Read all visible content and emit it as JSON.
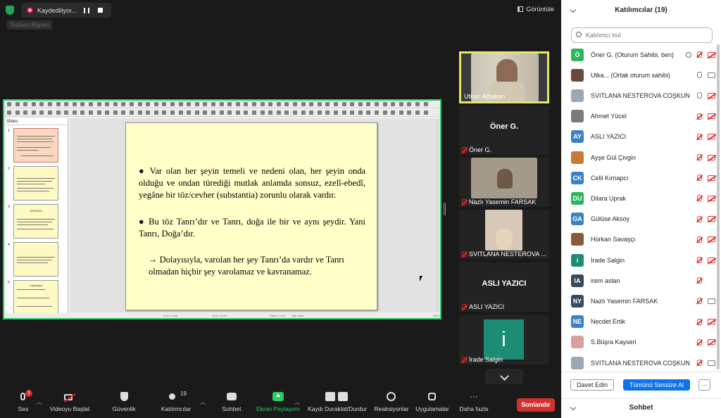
{
  "topbar": {
    "recording_label": "Kaydediliyor...",
    "meeting_info": "Toplantı Bilgileri",
    "view_label": "Görüntüle"
  },
  "slide": {
    "pane_title": "Slides",
    "bullet1": "● Var olan her şeyin temeli ve nedeni olan, her şeyin onda olduğu ve ondan türediği mutlak anlamda sonsuz, ezelî-ebedî, yegâne bir töz/cevher (substantia) zorunlu olarak vardır.",
    "bullet2": "● Bu töz Tanrı’dır ve Tanrı, doğa ile bir ve aynı şeydir.  Yani Tanrı, Doğa’dır.",
    "bullet3": "→  Dolayısıyla, varolan her şey Tanrı’da vardır ve Tanrı olmadan hiçbir şey varolamaz ve kavranamaz.",
    "thumb_numbers": [
      "1",
      "2",
      "3",
      "4",
      "5"
    ],
    "thumb3_title": "SPINOZA",
    "thumb5_title": "Kaynakça",
    "status": [
      "12,97 / 6,85",
      "0,00 x 0,00",
      "Slide 1 of 12",
      "Title Slide",
      "82%"
    ]
  },
  "video_tiles": [
    {
      "name": "Utkan Atbakan",
      "active": true
    },
    {
      "name": "Öner G.",
      "big": "Öner G."
    },
    {
      "name": "Nazlı Yasemin FARSAK"
    },
    {
      "name": "SVITLANA NESTEROVA ..."
    },
    {
      "name": "ASLI YAZICI",
      "big": "ASLI YAZICI"
    },
    {
      "name": "İrade Salgin",
      "avatar": "i"
    }
  ],
  "bottombar": {
    "mute": "Ses",
    "mute_badge": "1",
    "video": "Videoyu Başlat",
    "security": "Güvenlik",
    "participants": "Katılımcılar",
    "participant_count": "19",
    "chat": "Sohbet",
    "share": "Ekran Paylaşımı",
    "record": "Kaydı Duraklat/Durdur",
    "reactions": "Reaksiyonlar",
    "apps": "Uygulamalar",
    "more": "Daha fazla",
    "end": "Sonlandır"
  },
  "panel": {
    "title": "Katılımcılar (19)",
    "search_placeholder": "Katılımcı bul",
    "invite": "Davet Edin",
    "mute_all": "Tümünü Sessize Al",
    "more": "···",
    "chat_title": "Sohbet",
    "participants": [
      {
        "initials": "Ö",
        "name": "Öner G. (Oturum Sahibi, ben)",
        "color": "#2db55d",
        "mic": "off",
        "video": "off",
        "host": true
      },
      {
        "initials": "",
        "name": "Utka... (Ortak oturum sahibi)",
        "color": "#6b4a3a",
        "mic": "on",
        "video": "on",
        "photo": true
      },
      {
        "initials": "",
        "name": "SVITLANA NESTEROVA COŞKUN",
        "color": "#9aa7b5",
        "mic": "on",
        "video": "off",
        "photo": true
      },
      {
        "initials": "",
        "name": "Ahmet Yücel",
        "color": "#7a7a7a",
        "mic": "off",
        "video": "off",
        "photo": true
      },
      {
        "initials": "AY",
        "name": "ASLI YAZICI",
        "color": "#3b82c4",
        "mic": "off",
        "video": "off"
      },
      {
        "initials": "",
        "name": "Ayşe Gül Çivgin",
        "color": "#c77a3a",
        "mic": "off",
        "video": "off",
        "photo": true
      },
      {
        "initials": "CK",
        "name": "Celil Kırnapcı",
        "color": "#3b82c4",
        "mic": "off",
        "video": "off"
      },
      {
        "initials": "DU",
        "name": "Dilara Uprak",
        "color": "#2db55d",
        "mic": "off",
        "video": "off"
      },
      {
        "initials": "GA",
        "name": "Gülüse Aksoy",
        "color": "#3b82c4",
        "mic": "off",
        "video": "off"
      },
      {
        "initials": "",
        "name": "Hürkan Savaşçı",
        "color": "#8a5a3a",
        "mic": "off",
        "video": "off",
        "photo": true
      },
      {
        "initials": "i",
        "name": "İrade Salgin",
        "color": "#1c8d74",
        "mic": "off",
        "video": "off"
      },
      {
        "initials": "IA",
        "name": "irem aslan",
        "color": "#3a4a5e",
        "mic": "off",
        "video": "none"
      },
      {
        "initials": "NY",
        "name": "Nazlı Yasemin FARSAK",
        "color": "#3a4a5e",
        "mic": "off",
        "video": "on"
      },
      {
        "initials": "NE",
        "name": "Necdet Ertik",
        "color": "#3b82c4",
        "mic": "off",
        "video": "off"
      },
      {
        "initials": "",
        "name": "S.Büşra Kayseri",
        "color": "#d9a0a0",
        "mic": "off",
        "video": "off",
        "photo": true
      },
      {
        "initials": "",
        "name": "SVITLANA NESTEROVA COŞKUN",
        "color": "#9aa7b5",
        "mic": "off",
        "video": "on",
        "photo": true
      }
    ]
  }
}
